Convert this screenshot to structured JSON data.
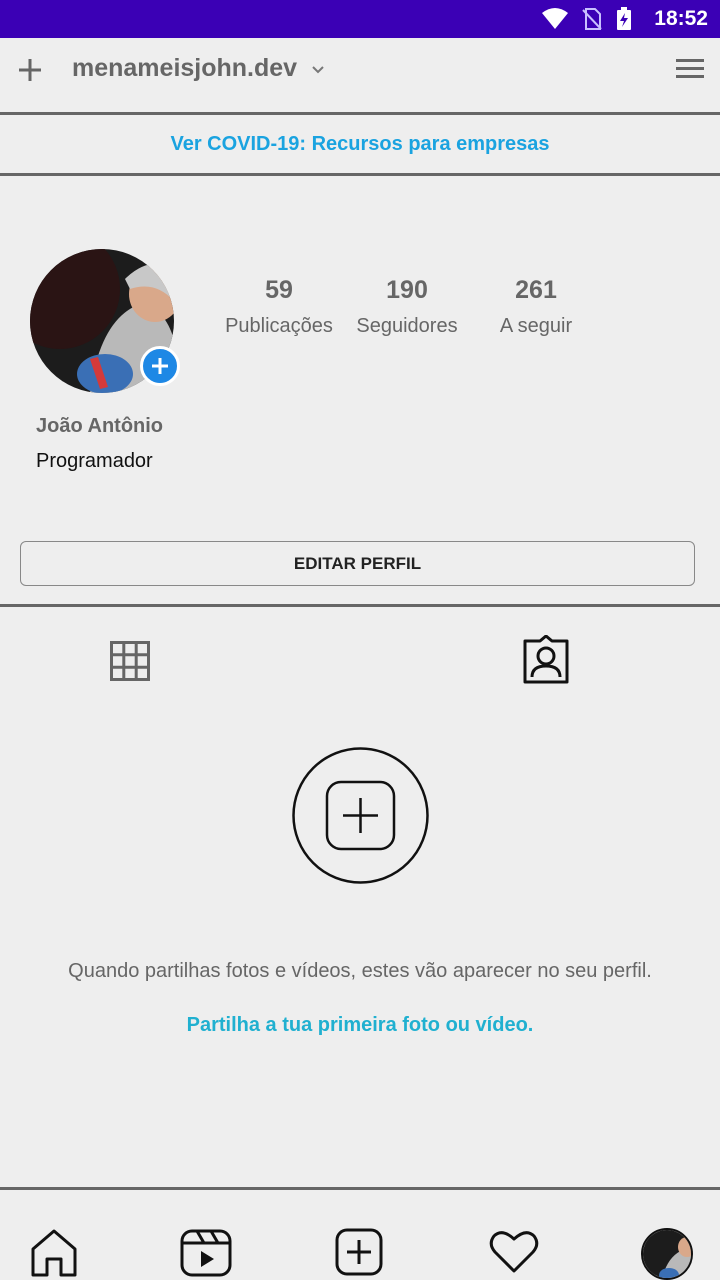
{
  "status_bar": {
    "time": "18:52",
    "icons": [
      "wifi-icon",
      "no-sim-icon",
      "battery-charging-icon"
    ],
    "background": "#3b00b5"
  },
  "header": {
    "username": "menameisjohn.dev",
    "icons": [
      "plus-icon",
      "chevron-down-icon",
      "hamburger-menu-icon"
    ]
  },
  "banner": {
    "text": "Ver COVID-19: Recursos para empresas",
    "color": "#1aa3e0"
  },
  "profile": {
    "stats": [
      {
        "value": "59",
        "label": "Publicações"
      },
      {
        "value": "190",
        "label": "Seguidores"
      },
      {
        "value": "261",
        "label": "A seguir"
      }
    ],
    "name": "João Antônio",
    "bio": "Programador",
    "edit_label": "EDITAR PERFIL"
  },
  "tabs": [
    "grid-icon",
    "tagged-icon"
  ],
  "empty_state": {
    "message": "Quando partilhas fotos e vídeos, estes vão aparecer no seu perfil.",
    "link": "Partilha a tua primeira foto ou vídeo.",
    "link_color": "#20b0d0"
  },
  "bottom_nav": [
    "home-icon",
    "reels-icon",
    "new-post-icon",
    "heart-icon",
    "profile-avatar"
  ]
}
